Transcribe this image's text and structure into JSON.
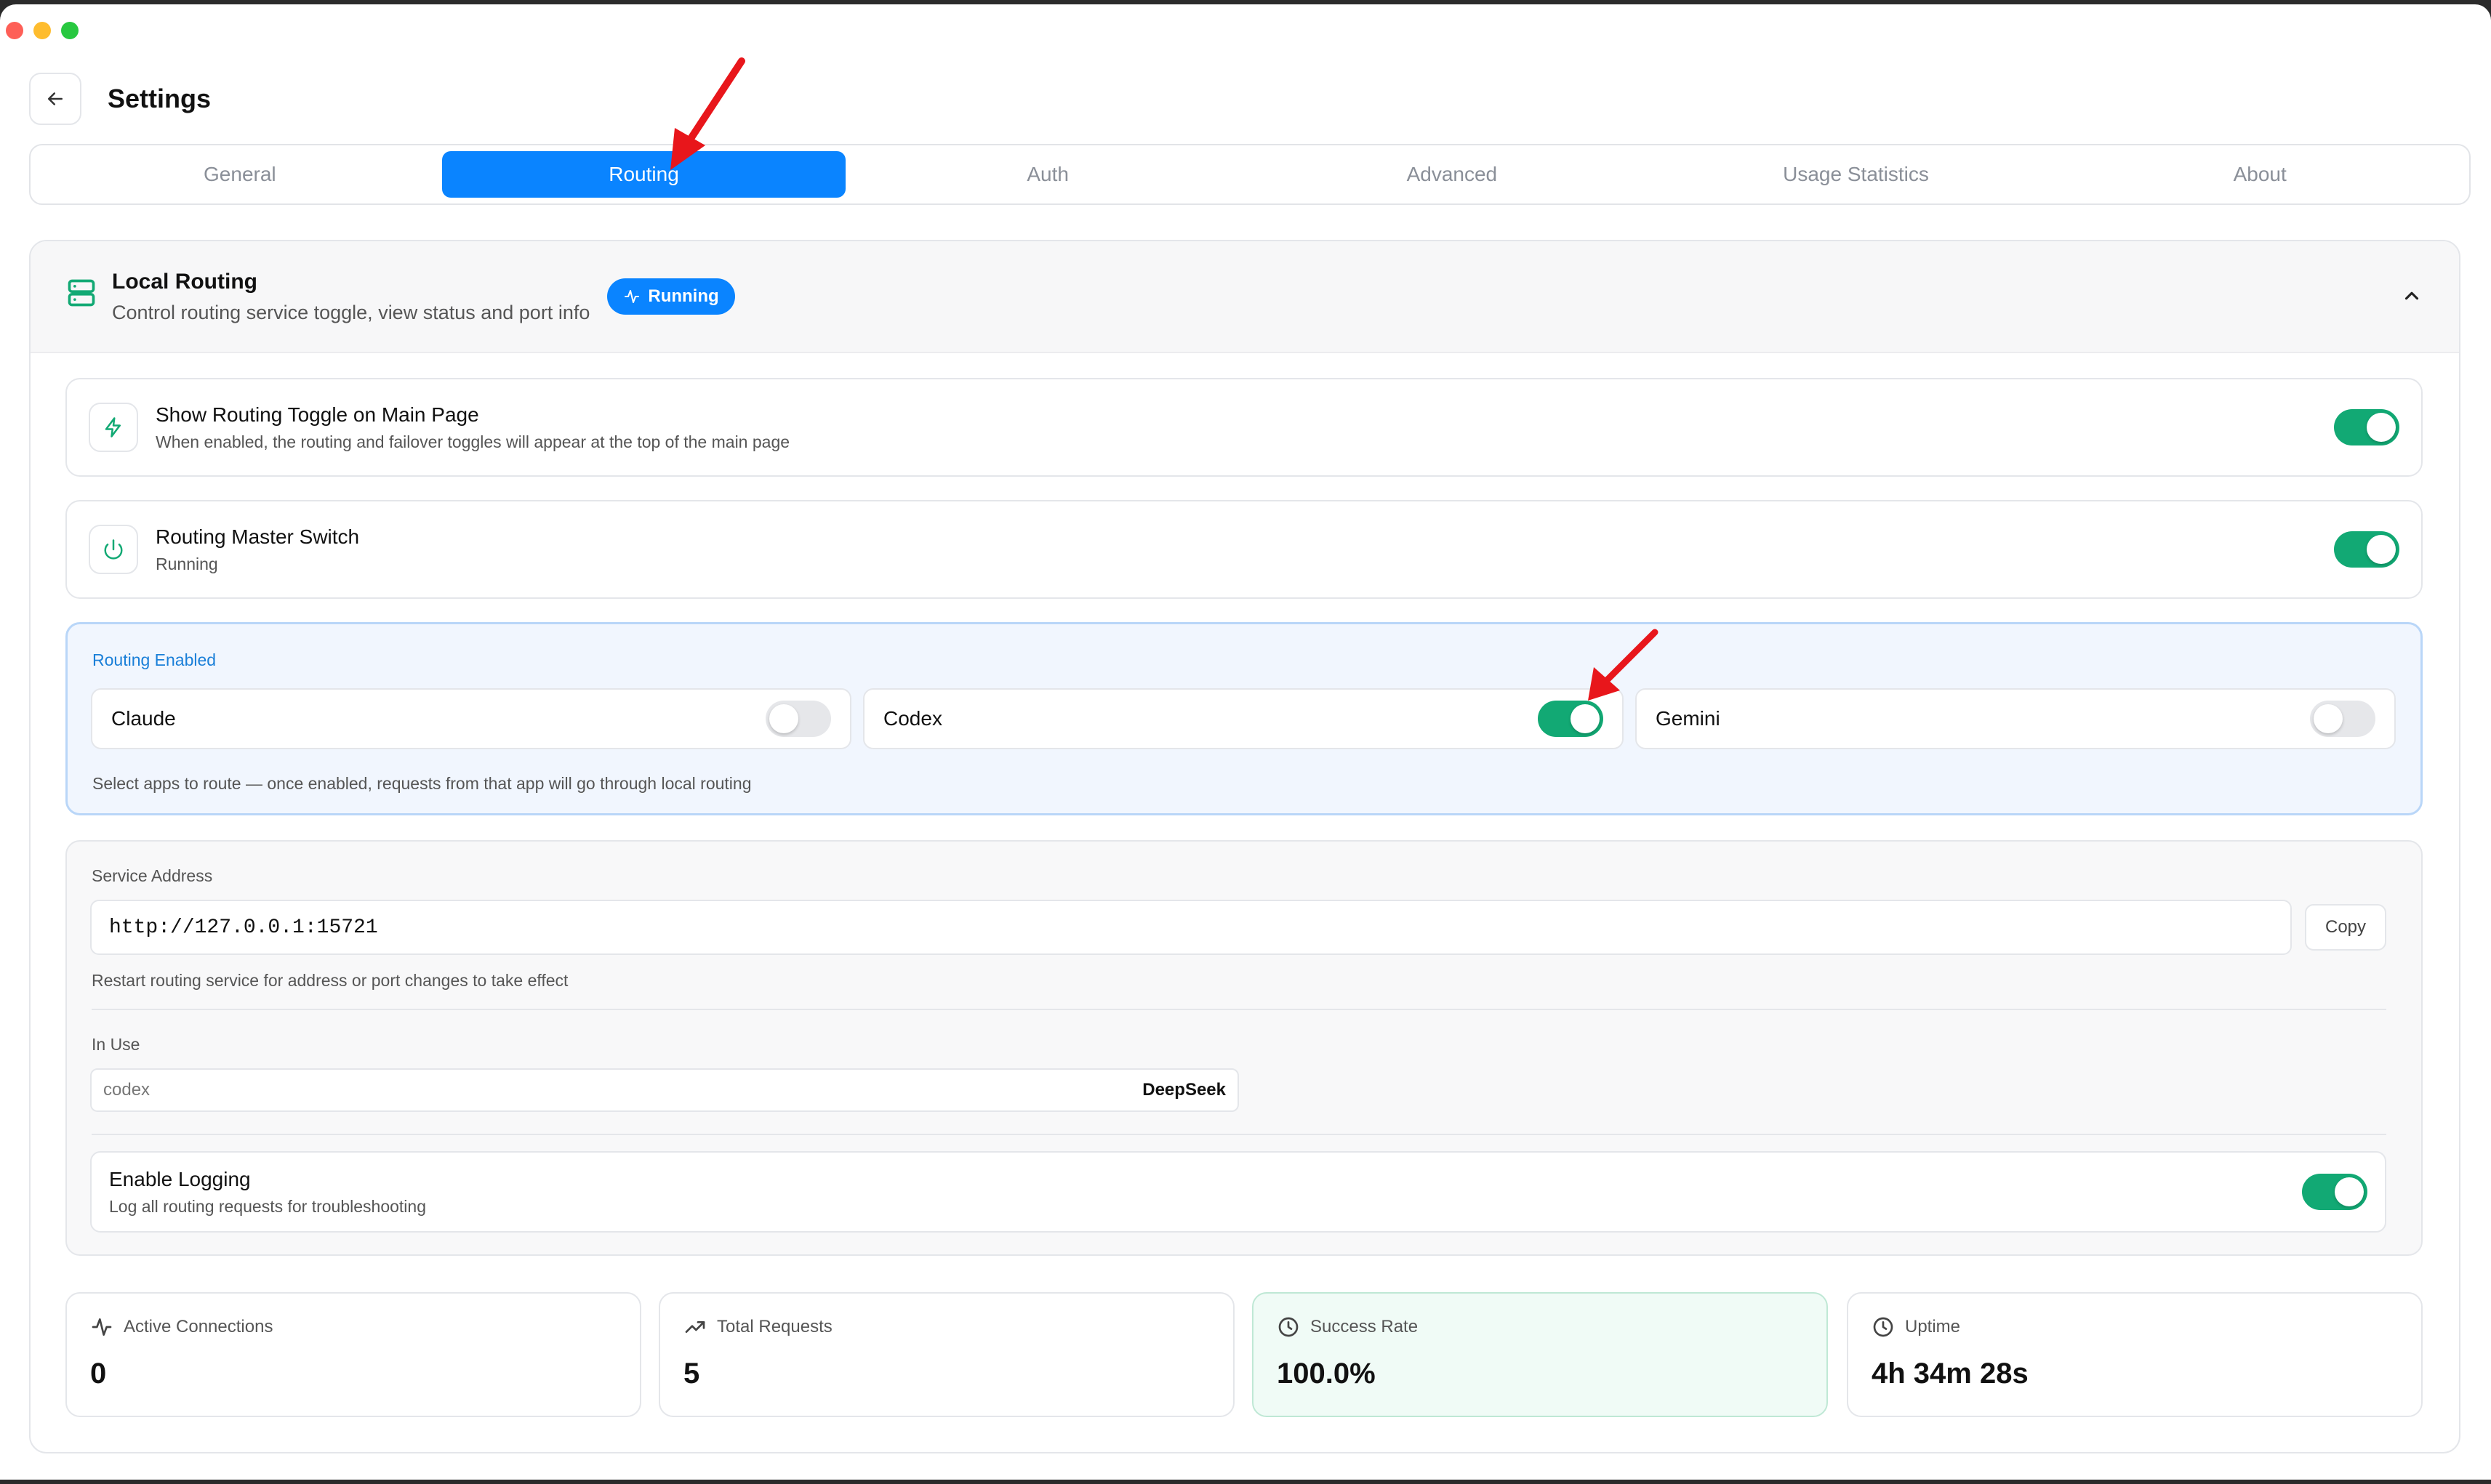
{
  "header": {
    "title": "Settings"
  },
  "tabs": [
    {
      "label": "General",
      "active": false
    },
    {
      "label": "Routing",
      "active": true
    },
    {
      "label": "Auth",
      "active": false
    },
    {
      "label": "Advanced",
      "active": false
    },
    {
      "label": "Usage Statistics",
      "active": false
    },
    {
      "label": "About",
      "active": false
    }
  ],
  "local_routing": {
    "title": "Local Routing",
    "subtitle": "Control routing service toggle, view status and port info",
    "badge": "Running"
  },
  "show_toggle": {
    "title": "Show Routing Toggle on Main Page",
    "subtitle": "When enabled, the routing and failover toggles will appear at the top of the main page",
    "on": true
  },
  "master_switch": {
    "title": "Routing Master Switch",
    "subtitle": "Running",
    "on": true
  },
  "routing_enabled": {
    "title": "Routing Enabled",
    "apps": [
      {
        "name": "Claude",
        "on": false
      },
      {
        "name": "Codex",
        "on": true
      },
      {
        "name": "Gemini",
        "on": false
      }
    ],
    "hint": "Select apps to route — once enabled, requests from that app will go through local routing"
  },
  "service": {
    "address_label": "Service Address",
    "address": "http://127.0.0.1:15721",
    "copy_label": "Copy",
    "restart_hint": "Restart routing service for address or port changes to take effect",
    "in_use_label": "In Use",
    "in_use_app": "codex",
    "in_use_provider": "DeepSeek"
  },
  "logging": {
    "title": "Enable Logging",
    "subtitle": "Log all routing requests for troubleshooting",
    "on": true
  },
  "stats": [
    {
      "label": "Active Connections",
      "value": "0",
      "icon": "activity-icon"
    },
    {
      "label": "Total Requests",
      "value": "5",
      "icon": "trending-up-icon"
    },
    {
      "label": "Success Rate",
      "value": "100.0%",
      "icon": "clock-icon"
    },
    {
      "label": "Uptime",
      "value": "4h 34m 28s",
      "icon": "clock-icon"
    }
  ],
  "colors": {
    "accent": "#0a84ff",
    "toggle_on": "#12a974",
    "routing_box": "#f1f6fe"
  }
}
